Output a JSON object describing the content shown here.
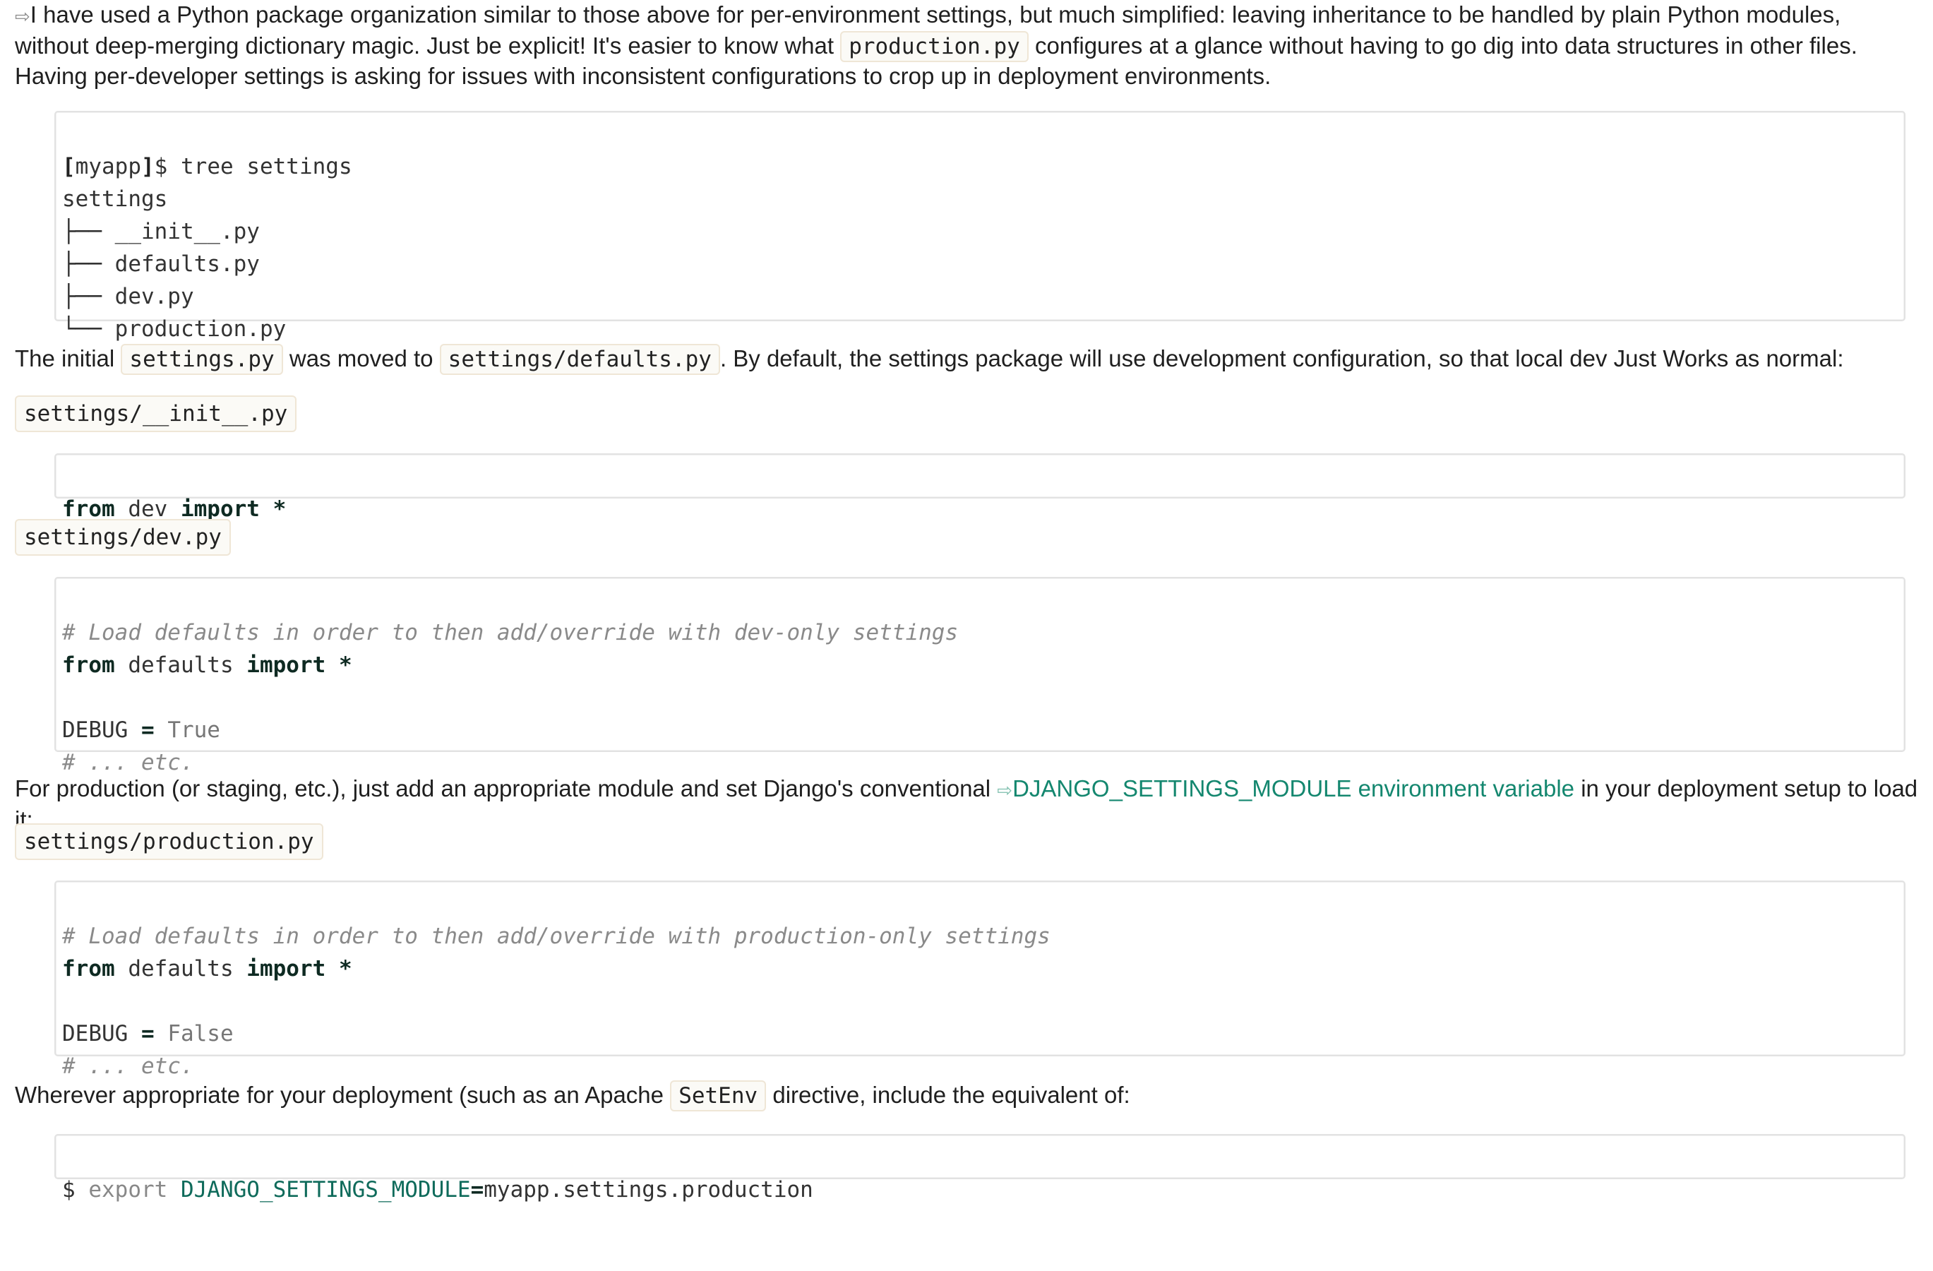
{
  "intro": {
    "ext_icon": "⇨",
    "text_before": "I have used a Python package organization similar to those above for per-environment settings, but much simplified: leaving inheritance to be handled by plain Python modules, without deep-merging dictionary magic. Just be explicit! It's easier to know what",
    "code": "production.py",
    "text_after": "configures at a glance without having to go dig into data structures in other files. Having per-developer settings is asking for issues with inconsistent configurations to crop up in deployment environments."
  },
  "tree_block": {
    "lines": [
      "[myapp]$ tree settings",
      "settings",
      "├── __init__.py",
      "├── defaults.py",
      "├── dev.py",
      "└── production.py"
    ],
    "prompt_open": "[",
    "prompt_mid": "myapp",
    "prompt_close": "]",
    "command": "$ tree settings"
  },
  "para2": {
    "t1": "The initial",
    "code1": "settings.py",
    "t2": "was moved to",
    "code2": "settings/defaults.py",
    "t3": ". By default, the settings package will use development configuration, so that local dev Just Works as normal:"
  },
  "file_init": "settings/__init__.py",
  "init_block": {
    "kw1": "from",
    "mod": " dev ",
    "kw2": "import",
    "star": " *"
  },
  "file_dev": "settings/dev.py",
  "dev_block": {
    "comment": "# Load defaults in order to then add/override with dev-only settings",
    "kw1": "from",
    "mod": " defaults ",
    "kw2": "import",
    "star": " *",
    "assign_var": "DEBUG ",
    "assign_op": "=",
    "assign_val": " True",
    "etc": "# ... etc."
  },
  "para3": {
    "t1": "For production (or staging, etc.), just add an appropriate module and set Django's conventional",
    "link_icon": "⇨",
    "link_text": "DJANGO_SETTINGS_MODULE environment variable",
    "t2": "in your deployment setup to load it:"
  },
  "file_prod": "settings/production.py",
  "prod_block": {
    "comment": "# Load defaults in order to then add/override with production-only settings",
    "kw1": "from",
    "mod": " defaults ",
    "kw2": "import",
    "star": " *",
    "assign_var": "DEBUG ",
    "assign_op": "=",
    "assign_val": " False",
    "etc": "# ... etc."
  },
  "para4": {
    "t1": "Wherever appropriate for your deployment (such as an Apache",
    "code": "SetEnv",
    "t2": "directive, include the equivalent of:"
  },
  "export_block": {
    "dollar": "$ ",
    "export": "export",
    "var": " DJANGO_SETTINGS_MODULE",
    "op": "=",
    "value": "myapp.settings.production"
  },
  "colors": {
    "link": "#14876f",
    "keyword": "#0e2a22",
    "comment": "#8a8a8a",
    "inline_code_border": "#efe6d6"
  }
}
